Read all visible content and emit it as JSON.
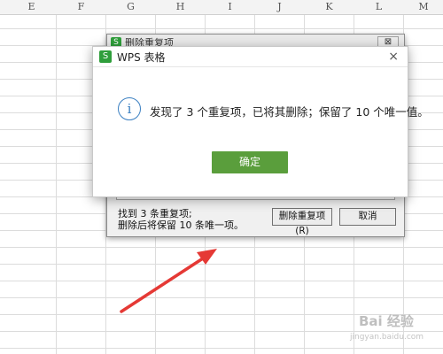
{
  "sheet": {
    "columns": [
      "E",
      "F",
      "G",
      "H",
      "I",
      "J",
      "K",
      "L",
      "M"
    ]
  },
  "back_dialog": {
    "title": "删除重复项",
    "close": "⊠",
    "info_line1": "找到 3 条重复项;",
    "info_line2": "删除后将保留 10 条唯一项。",
    "delete_button": "删除重复项(R)",
    "cancel_button": "取消"
  },
  "dialog": {
    "logo": "S",
    "title": "WPS 表格",
    "close": "×",
    "icon": "i",
    "message": "发现了 3 个重复项，已将其删除；保留了 10 个唯一值。",
    "ok_button": "确定"
  },
  "watermark": {
    "text": "Bai 经验",
    "sub": "jingyan.baidu.com"
  },
  "icons": {
    "info": "info-icon",
    "close": "close-icon",
    "arrow": "arrow-icon"
  },
  "colors": {
    "ok": "#5a9e3c",
    "logo": "#2f9e3b",
    "info": "#3a7fc1",
    "arrow": "#e53935"
  }
}
